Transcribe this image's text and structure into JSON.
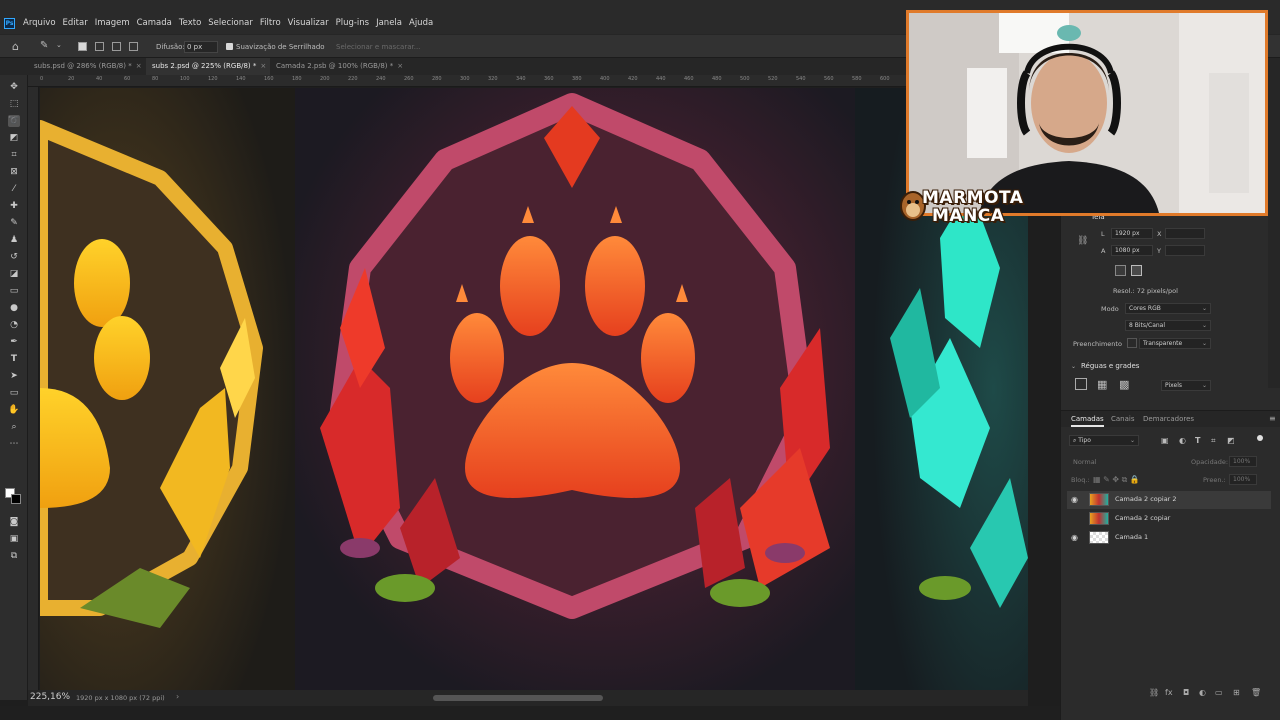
{
  "app": {
    "logo": "Ps",
    "menu": [
      "Arquivo",
      "Editar",
      "Imagem",
      "Camada",
      "Texto",
      "Selecionar",
      "Filtro",
      "Visualizar",
      "Plug-ins",
      "Janela",
      "Ajuda"
    ]
  },
  "options": {
    "feather_label": "Difusão:",
    "feather_value": "0 px",
    "antialias_label": "Suavização de Serrilhado",
    "select_mask_label": "Selecionar e mascarar..."
  },
  "tabs": [
    {
      "label": "subs.psd @ 286% (RGB/8) *",
      "active": false
    },
    {
      "label": "subs 2.psd @ 225% (RGB/8) *",
      "active": true
    },
    {
      "label": "Camada 2.psb @ 100% (RGB/8) *",
      "active": false
    }
  ],
  "ruler_numbers": [
    "0",
    "20",
    "40",
    "60",
    "80",
    "100",
    "120",
    "140",
    "160",
    "180",
    "200",
    "220",
    "240",
    "260",
    "280",
    "300",
    "320",
    "340",
    "360",
    "380",
    "400",
    "420",
    "440",
    "460",
    "480",
    "500",
    "520",
    "540",
    "560",
    "580",
    "600",
    "620",
    "640",
    "660",
    "680"
  ],
  "status": {
    "zoom": "225,16%",
    "doc_info": "1920 px x 1080 px (72 ppi)"
  },
  "properties": {
    "section": "Tela",
    "width_label": "L",
    "width_value": "1920 px",
    "height_label": "A",
    "height_value": "1080 px",
    "x_label": "X",
    "y_label": "Y",
    "resolution": "Resol.: 72 pixels/pol",
    "mode_label": "Modo",
    "mode_value": "Cores RGB",
    "depth_value": "8 Bits/Canal",
    "fill_label": "Preenchimento",
    "fill_value": "Transparente",
    "rulers_section": "Réguas e grades",
    "units_value": "Pixels"
  },
  "layers_panel": {
    "tabs": [
      "Camadas",
      "Canais",
      "Demarcadores"
    ],
    "filter_label": "Tipo",
    "blend_mode": "Normal",
    "opacity_label": "Opacidade:",
    "opacity_value": "100%",
    "lock_label": "Bloq.:",
    "fill_label": "Preen.:",
    "fill_value": "100%",
    "layers": [
      {
        "name": "Camada 2 copiar 2",
        "visible": true
      },
      {
        "name": "Camada 2 copiar",
        "visible": false
      },
      {
        "name": "Camada 1",
        "visible": true
      }
    ]
  },
  "brand": {
    "line1": "MARMOTA",
    "line2": "MANCA"
  },
  "colors": {
    "accent": "#e07a2a",
    "ps_blue": "#31a8ff"
  }
}
